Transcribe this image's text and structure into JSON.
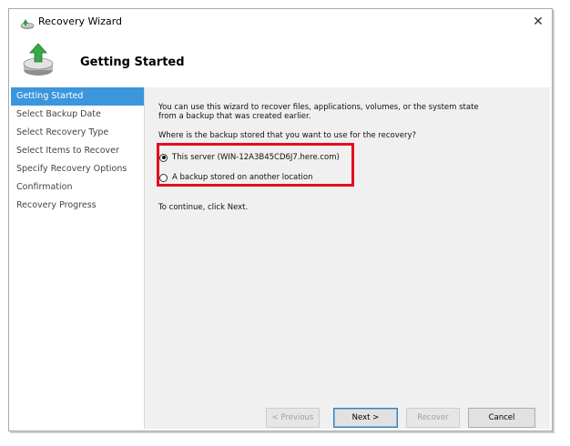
{
  "window": {
    "title": "Recovery Wizard",
    "close_glyph": "✕"
  },
  "header": {
    "title": "Getting Started",
    "icon": "recovery-wizard-icon"
  },
  "nav": {
    "items": [
      {
        "label": "Getting Started",
        "active": true
      },
      {
        "label": "Select Backup Date",
        "active": false
      },
      {
        "label": "Select Recovery Type",
        "active": false
      },
      {
        "label": "Select Items to Recover",
        "active": false
      },
      {
        "label": "Specify Recovery Options",
        "active": false
      },
      {
        "label": "Confirmation",
        "active": false
      },
      {
        "label": "Recovery Progress",
        "active": false
      }
    ]
  },
  "content": {
    "intro_line1": "You can use this wizard to recover files, applications, volumes, or the system state",
    "intro_line2": "from a backup that was created earlier.",
    "question": "Where is the backup stored that you want to use for the recovery?",
    "options": [
      {
        "label": "This server (WIN-12A3B45CD6J7.here.com)",
        "selected": true
      },
      {
        "label": "A backup stored on another location",
        "selected": false
      }
    ],
    "continue_text": "To continue, click Next."
  },
  "buttons": {
    "previous": "< Previous",
    "next": "Next >",
    "recover": "Recover",
    "cancel": "Cancel"
  },
  "colors": {
    "nav_active": "#3b96dc",
    "highlight": "#e0101d",
    "content_bg": "#f0f0f0"
  }
}
